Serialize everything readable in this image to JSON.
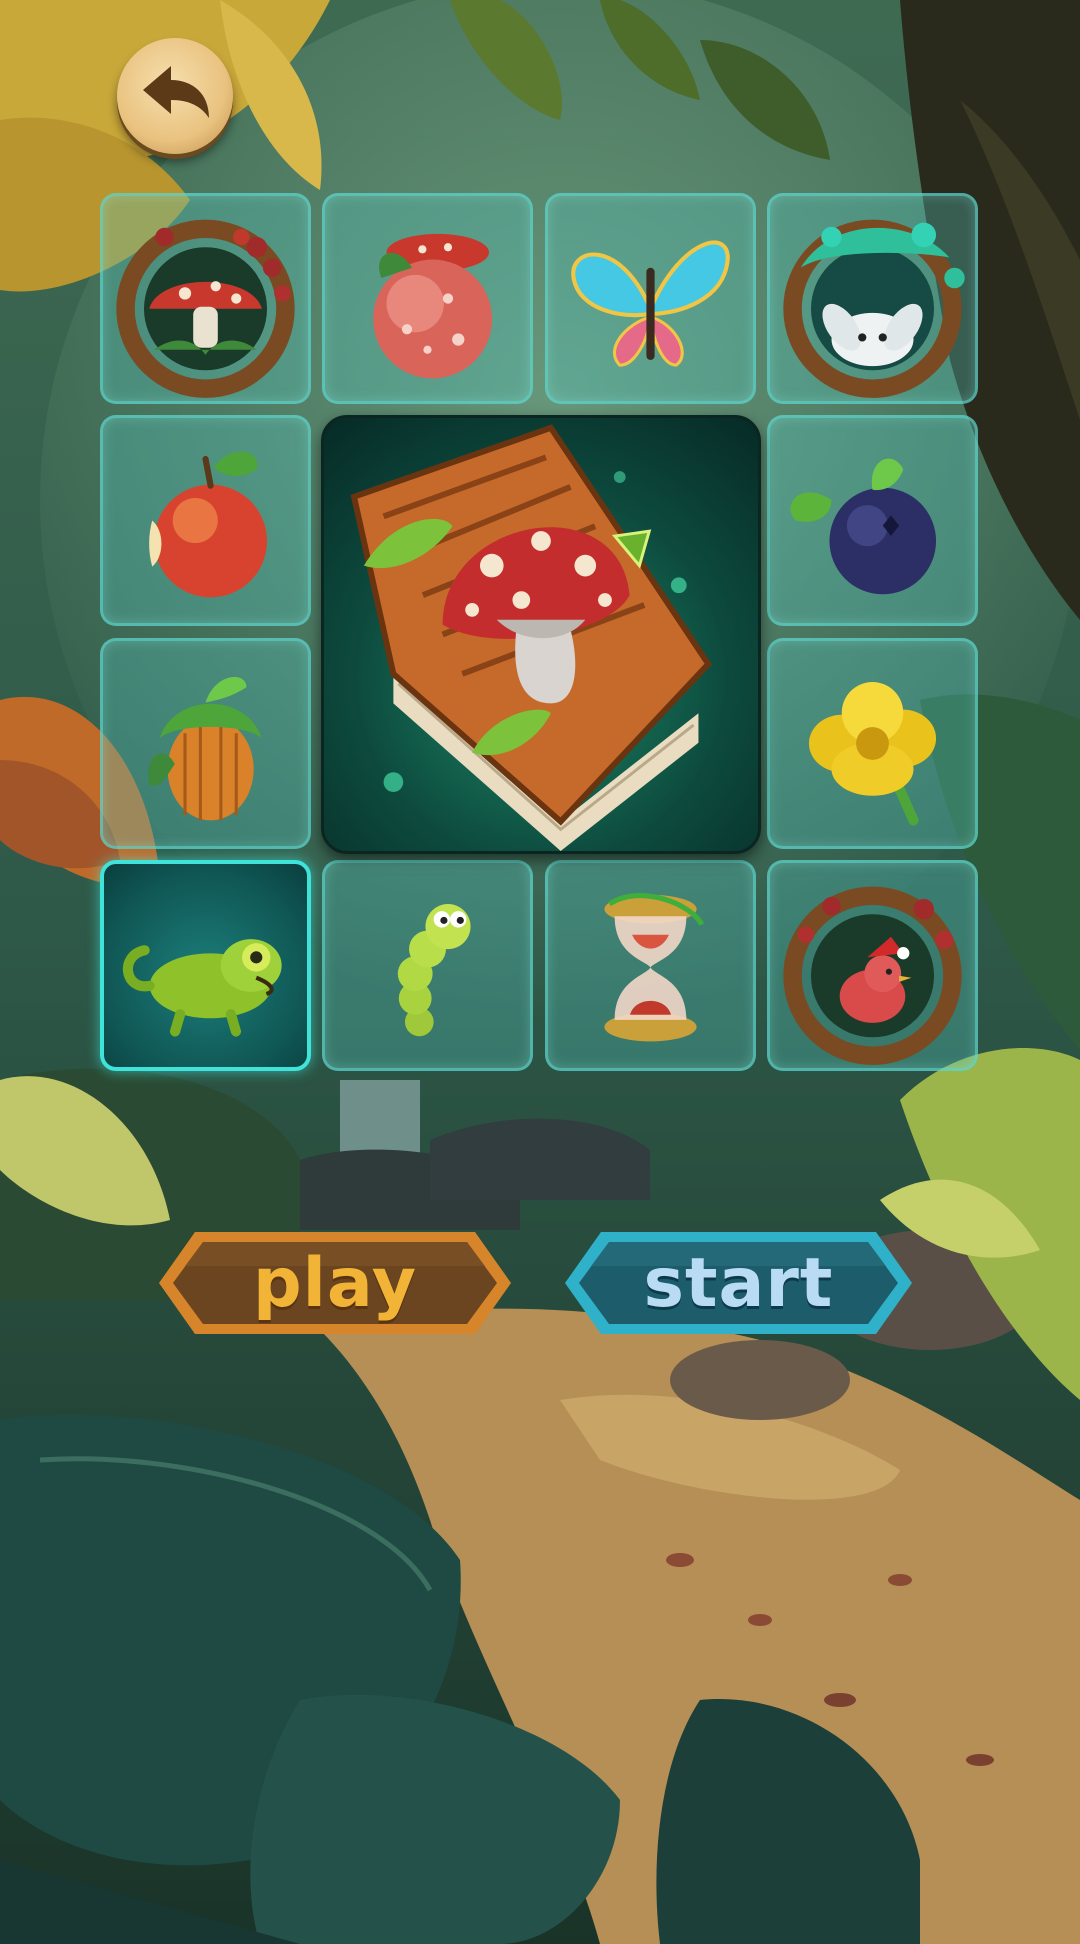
{
  "screen": {
    "back_button": {
      "icon": "undo-arrow-icon"
    },
    "board": {
      "featured_card": {
        "icon": "mushroom-storybook-icon"
      },
      "tiles": [
        {
          "icon": "mushroom-wreath-icon",
          "selected": false
        },
        {
          "icon": "magic-peach-icon",
          "selected": false
        },
        {
          "icon": "butterfly-icon",
          "selected": false
        },
        {
          "icon": "bunny-wreath-icon",
          "selected": false
        },
        {
          "icon": "bitten-apple-icon",
          "selected": false
        },
        {
          "icon": "blueberry-icon",
          "selected": false
        },
        {
          "icon": "hazelnut-icon",
          "selected": false
        },
        {
          "icon": "yellow-flower-icon",
          "selected": false
        },
        {
          "icon": "chameleon-icon",
          "selected": true
        },
        {
          "icon": "caterpillar-icon",
          "selected": false
        },
        {
          "icon": "hourglass-icon",
          "selected": false
        },
        {
          "icon": "bird-wreath-icon",
          "selected": false
        }
      ]
    },
    "buttons": {
      "play_label": "play",
      "start_label": "start"
    },
    "colors": {
      "play_button": "#6b4420",
      "play_text": "#f2b437",
      "start_button": "#1d5d6b",
      "start_text": "#b9dcf4",
      "tile_border": "#61dad0",
      "selected_border": "#3fe3da"
    }
  }
}
